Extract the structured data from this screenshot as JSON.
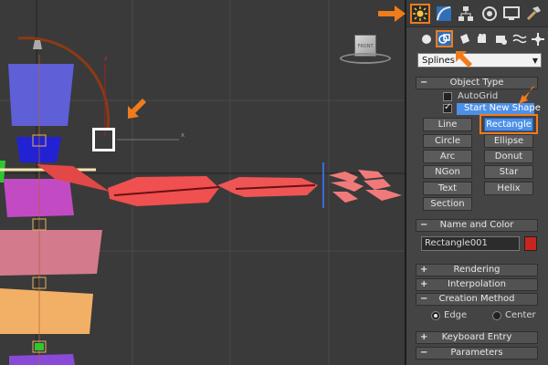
{
  "viewport": {
    "viewcube_label": "FRONT",
    "axis_z": "z",
    "axis_x": "x"
  },
  "command_panel": {
    "tabs": [
      {
        "icon": "create-sun-icon",
        "highlighted": true
      },
      {
        "icon": "modify-curve-icon"
      },
      {
        "icon": "hierarchy-icon"
      },
      {
        "icon": "motion-icon"
      },
      {
        "icon": "display-monitor-icon"
      },
      {
        "icon": "utilities-hammer-icon"
      }
    ],
    "categories": [
      {
        "icon": "geometry-sphere-icon"
      },
      {
        "icon": "shapes-icon",
        "highlighted": true
      },
      {
        "icon": "lights-icon"
      },
      {
        "icon": "cameras-icon"
      },
      {
        "icon": "helpers-icon"
      },
      {
        "icon": "space-warps-icon"
      },
      {
        "icon": "systems-icon"
      }
    ],
    "dropdown_value": "Splines",
    "object_type": {
      "title": "Object Type",
      "autogrid_label": "AutoGrid",
      "autogrid_checked": false,
      "start_new_shape_label": "Start New Shape",
      "start_new_shape_checked": true,
      "buttons": [
        {
          "label": "Line"
        },
        {
          "label": "Rectangle",
          "active": true
        },
        {
          "label": "Circle"
        },
        {
          "label": "Ellipse"
        },
        {
          "label": "Arc"
        },
        {
          "label": "Donut"
        },
        {
          "label": "NGon"
        },
        {
          "label": "Star"
        },
        {
          "label": "Text"
        },
        {
          "label": "Helix"
        },
        {
          "label": "Section"
        }
      ]
    },
    "name_and_color": {
      "title": "Name and Color",
      "name_value": "Rectangle001",
      "color": "#c8251f"
    },
    "rendering_title": "Rendering",
    "interpolation_title": "Interpolation",
    "creation_method": {
      "title": "Creation Method",
      "edge_label": "Edge",
      "center_label": "Center",
      "selected": "Edge"
    },
    "keyboard_entry_title": "Keyboard Entry",
    "parameters_title": "Parameters"
  },
  "colors": {
    "highlight_orange": "#f07c1c",
    "active_button_blue": "#4d90e8",
    "viewport_bg": "#3a3a3a",
    "panel_bg": "#444444"
  }
}
